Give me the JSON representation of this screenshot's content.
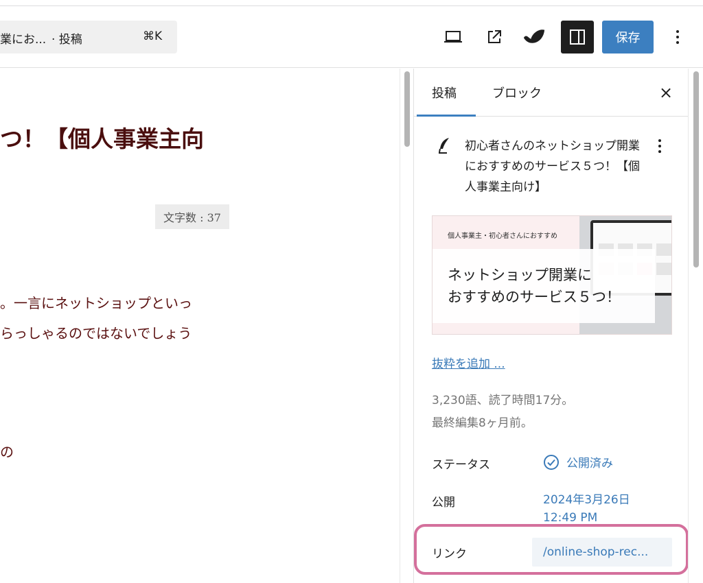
{
  "header": {
    "command_title": "業にお...",
    "command_type": "· 投稿",
    "shortcut": "⌘K",
    "save_label": "保存"
  },
  "editor": {
    "title_partial": "つ！【個人事業主向",
    "word_count": "文字数 : 37",
    "paragraph_lines": [
      "。一言にネットショップといっ",
      "らっしゃるのではないでしょう",
      "の"
    ]
  },
  "sidebar": {
    "tabs": [
      {
        "label": "投稿",
        "active": true
      },
      {
        "label": "ブロック",
        "active": false
      }
    ],
    "close_label": "×",
    "post_title": "初心者さんのネットショップ開業におすすめのサービス５つ！【個人事業主向け】",
    "thumbnail": {
      "small_text": "個人事業主・初心者さんにおすすめ",
      "line1": "ネットショップ開業に",
      "line2": "おすすめのサービス５つ！"
    },
    "excerpt_link": "抜粋を追加 ...",
    "meta": [
      "3,230語、読了時間17分。",
      "最終編集8ヶ月前。"
    ],
    "status_label": "ステータス",
    "status_value": "公開済み",
    "publish_label": "公開",
    "publish_date": "2024年3月26日",
    "publish_time": "12:49 PM",
    "link_label": "リンク",
    "link_value": "/online-shop-rec..."
  },
  "icons": {
    "preview": "laptop-icon",
    "view_post": "external-link-icon",
    "jetpack": "leaf-logo-icon",
    "sidebar_toggle": "sidebar-panel-icon",
    "more": "vertical-ellipsis-icon",
    "post": "feather-pen-icon",
    "status": "check-circle-icon"
  },
  "colors": {
    "accent": "#3c7fc0",
    "title": "#4a0e0e",
    "highlight": "#d4709c"
  }
}
